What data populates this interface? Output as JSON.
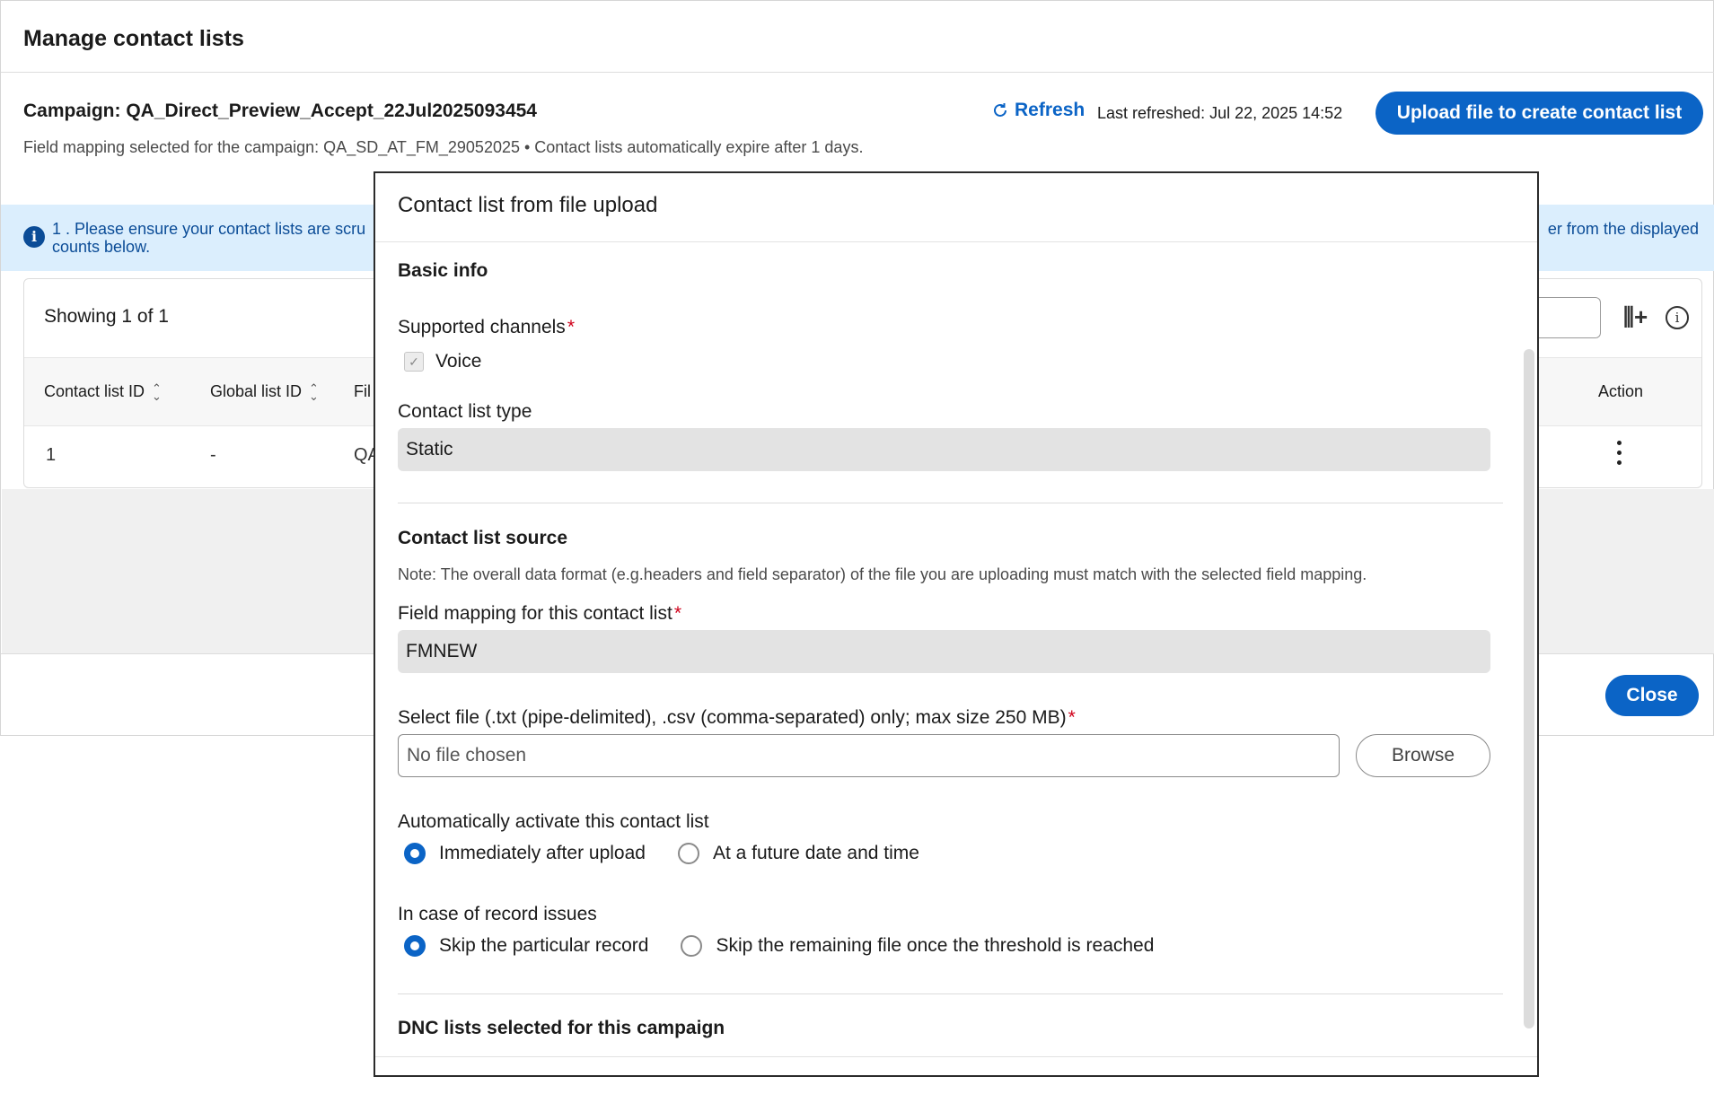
{
  "page": {
    "title": "Manage contact lists",
    "campaign": "Campaign: QA_Direct_Preview_Accept_22Jul2025093454",
    "subline": "Field mapping selected for the campaign: QA_SD_AT_FM_29052025 • Contact lists automatically expire after 1 days.",
    "refresh_label": "Refresh",
    "last_refreshed": "Last refreshed: Jul 22, 2025 14:52",
    "upload_button": "Upload file to create contact list",
    "banner_line1": "1 . Please ensure your contact lists are scru",
    "banner_line2": "counts below.",
    "banner_right": "er from the displayed",
    "showing": "Showing 1 of 1",
    "columns": [
      "Contact list ID",
      "Global list ID",
      "Fil",
      "Action"
    ],
    "row": [
      "1",
      "-",
      "QA"
    ],
    "close_button": "Close"
  },
  "modal": {
    "title": "Contact list from file upload",
    "basic_info": "Basic info",
    "supported_channels_label": "Supported channels",
    "voice_label": "Voice",
    "list_type_label": "Contact list type",
    "list_type_value": "Static",
    "source_heading": "Contact list source",
    "source_note": "Note: The overall data format (e.g.headers and field separator) of the file you are uploading must match with the selected field mapping.",
    "field_mapping_label": "Field mapping for this contact list",
    "field_mapping_value": "FMNEW",
    "select_file_label": "Select file (.txt (pipe-delimited), .csv (comma-separated) only; max size 250 MB)",
    "file_placeholder": "No file chosen",
    "browse_button": "Browse",
    "activate_label": "Automatically activate this contact list",
    "activate_options": [
      "Immediately after upload",
      "At a future date and time"
    ],
    "record_issues_label": "In case of record issues",
    "record_options": [
      "Skip the particular record",
      "Skip the remaining file once the threshold is reached"
    ],
    "dnc_heading": "DNC lists selected for this campaign"
  },
  "icons": {
    "refresh": "refresh-icon",
    "info": "info-icon",
    "columns": "add-column-icon",
    "sort": "sort-icon",
    "kebab": "more-options-icon",
    "check": "check-icon"
  },
  "colors": {
    "primary": "#0b64c6",
    "banner_bg": "#dbeefd",
    "banner_text": "#0b4c97",
    "required": "#d0021b"
  }
}
